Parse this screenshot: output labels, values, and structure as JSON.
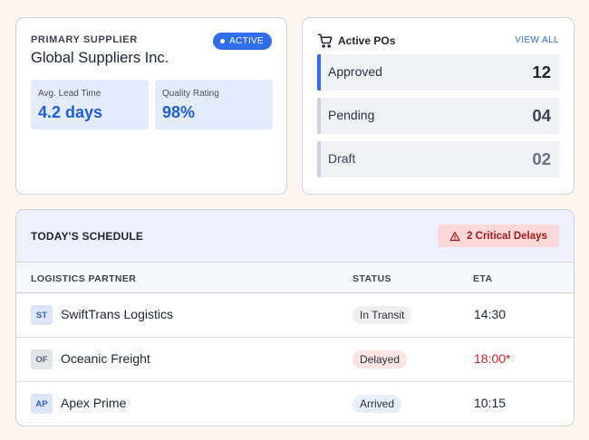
{
  "supplier": {
    "kicker": "PRIMARY SUPPLIER",
    "status_badge": "ACTIVE",
    "name": "Global Suppliers Inc.",
    "metrics": [
      {
        "label": "Avg. Lead Time",
        "value": "4.2 days"
      },
      {
        "label": "Quality Rating",
        "value": "98%"
      }
    ]
  },
  "pos": {
    "icon": "cart-icon",
    "title": "Active POs",
    "view_all": "VIEW ALL",
    "rows": [
      {
        "label": "Approved",
        "count": "12"
      },
      {
        "label": "Pending",
        "count": "04"
      },
      {
        "label": "Draft",
        "count": "02"
      }
    ]
  },
  "schedule": {
    "title": "TODAY'S SCHEDULE",
    "alert_icon": "warning-icon",
    "alert": "2 Critical Delays",
    "columns": {
      "partner": "LOGISTICS PARTNER",
      "status": "STATUS",
      "eta": "ETA"
    },
    "rows": [
      {
        "initials": "ST",
        "partner": "SwiftTrans Logistics",
        "status": "In Transit",
        "eta": "14:30"
      },
      {
        "initials": "OF",
        "partner": "Oceanic Freight",
        "status": "Delayed",
        "eta": "18:00*"
      },
      {
        "initials": "AP",
        "partner": "Apex Prime",
        "status": "Arrived",
        "eta": "10:15"
      }
    ]
  },
  "colors": {
    "accent": "#2f6ee8",
    "danger": "#c62828",
    "background": "#fdf5ee"
  }
}
